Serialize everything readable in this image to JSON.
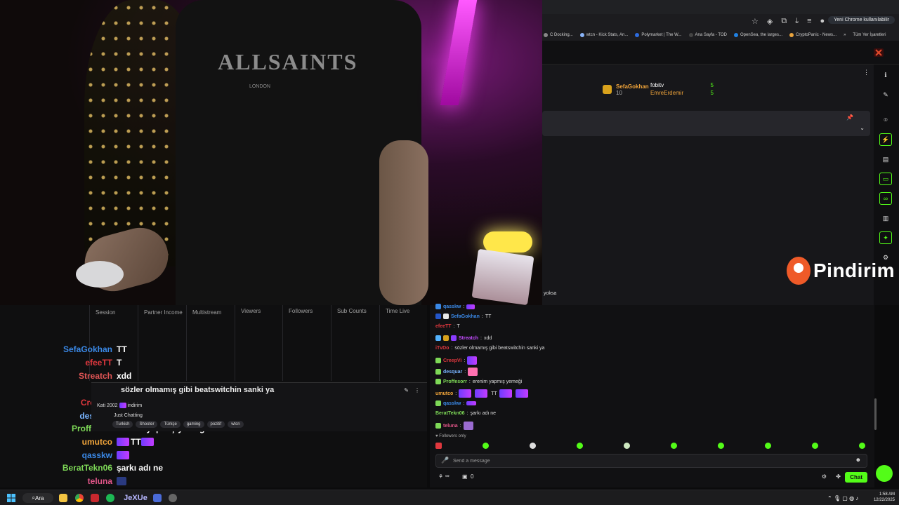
{
  "browser": {
    "update_button": "Yeni Chrome kullanılabilir",
    "bookmarks": [
      {
        "label": "C Docking...",
        "color": "#888888"
      },
      {
        "label": "wtcn - Kick Stats, An...",
        "color": "#8ab4f8"
      },
      {
        "label": "Polymarket | The W...",
        "color": "#2d6cdf"
      },
      {
        "label": "Ana Sayfa - TOD",
        "color": "#444444"
      },
      {
        "label": "OpenSea, the larges...",
        "color": "#2081e2"
      },
      {
        "label": "CryptoPanic - News...",
        "color": "#e8a33d"
      }
    ],
    "bookmarks_more": "»",
    "all_bookmarks": "Tüm Yer İşaretleri"
  },
  "leaderboard": {
    "top": {
      "name": "SefaGokhan",
      "value": "10"
    },
    "list": [
      {
        "name": "fobitv",
        "value": "5",
        "color": "#ffffff"
      },
      {
        "name": "EmreErdemir",
        "value": "5",
        "color": "#f0a43a"
      }
    ]
  },
  "overlay": {
    "brand": "Pindirim",
    "fragment": "yoksa"
  },
  "stats": {
    "columns": [
      "Session",
      "Partner Income",
      "Multistream",
      "Viewers",
      "Followers",
      "Sub Counts",
      "Time Live"
    ]
  },
  "overlay_chat": [
    {
      "name": "SefaGokhan",
      "color": "#3a88e6",
      "msg": "TT"
    },
    {
      "name": "efeeTT",
      "color": "#e0383e",
      "msg": "T"
    },
    {
      "name": "Streatch",
      "color": "#e05555",
      "msg": "xdd"
    },
    {
      "name": "",
      "color": "#ffffff",
      "msg": ""
    },
    {
      "name": "CreepVi",
      "color": "#e0383e",
      "msg": ""
    },
    {
      "name": "desquar",
      "color": "#78b4ff",
      "msg": ""
    },
    {
      "name": "Proffesorr",
      "color": "#7ed957",
      "msg": "erenim yapmış yemeği"
    },
    {
      "name": "umutco",
      "color": "#f0a43a",
      "msg": "TT"
    },
    {
      "name": "qasskw",
      "color": "#3a88e6",
      "msg": ""
    },
    {
      "name": "BeratTekn06",
      "color": "#7ed957",
      "msg": "şarkı adı ne"
    },
    {
      "name": "teluna",
      "color": "#e05588",
      "msg": ""
    }
  ],
  "pinned": {
    "title": "sözler olmamış gibi beatswitchin sanki ya",
    "streamer": "Kati 2002",
    "streamer_suffix": "indirim",
    "desc": "Just Chatting",
    "tags": [
      "Turkish",
      "Shooter",
      "Türkçe",
      "gaming",
      "pozitif",
      "wtcn"
    ]
  },
  "chat": {
    "messages": [
      {
        "name": "qasskw",
        "color": "#3a88e6",
        "msg": ""
      },
      {
        "name": "SefaGokhan",
        "color": "#3a88e6",
        "msg": "TT"
      },
      {
        "name": "efeeTT",
        "color": "#e0383e",
        "msg": "T"
      },
      {
        "name": "Streatch",
        "color": "#c44cff",
        "msg": "xdd"
      },
      {
        "name": "iTvDo",
        "color": "#e0383e",
        "msg": "sözler olmamış gibi beatswitchin sanki ya"
      },
      {
        "name": "CreepVi",
        "color": "#e0383e",
        "msg": ""
      },
      {
        "name": "desquar",
        "color": "#78b4ff",
        "msg": ""
      },
      {
        "name": "Proffesorr",
        "color": "#7ed957",
        "msg": "erenim yapmış yemeği"
      },
      {
        "name": "umutco",
        "color": "#f0a43a",
        "msg": "TT"
      },
      {
        "name": "qasskw",
        "color": "#3a88e6",
        "msg": ""
      },
      {
        "name": "BeratTekn06",
        "color": "#7ed957",
        "msg": "şarkı adı ne"
      },
      {
        "name": "teluna",
        "color": "#e05588",
        "msg": ""
      }
    ],
    "followers_only": "Followers only",
    "input_placeholder": "Send a message",
    "points": "∞",
    "gifts": "0",
    "chat_button": "Chat"
  },
  "taskbar": {
    "search": "Ara",
    "time": "1:58 AM",
    "date": "12/22/2025"
  },
  "colors": {
    "kick_green": "#53fc18",
    "background": "#0f0f10"
  }
}
